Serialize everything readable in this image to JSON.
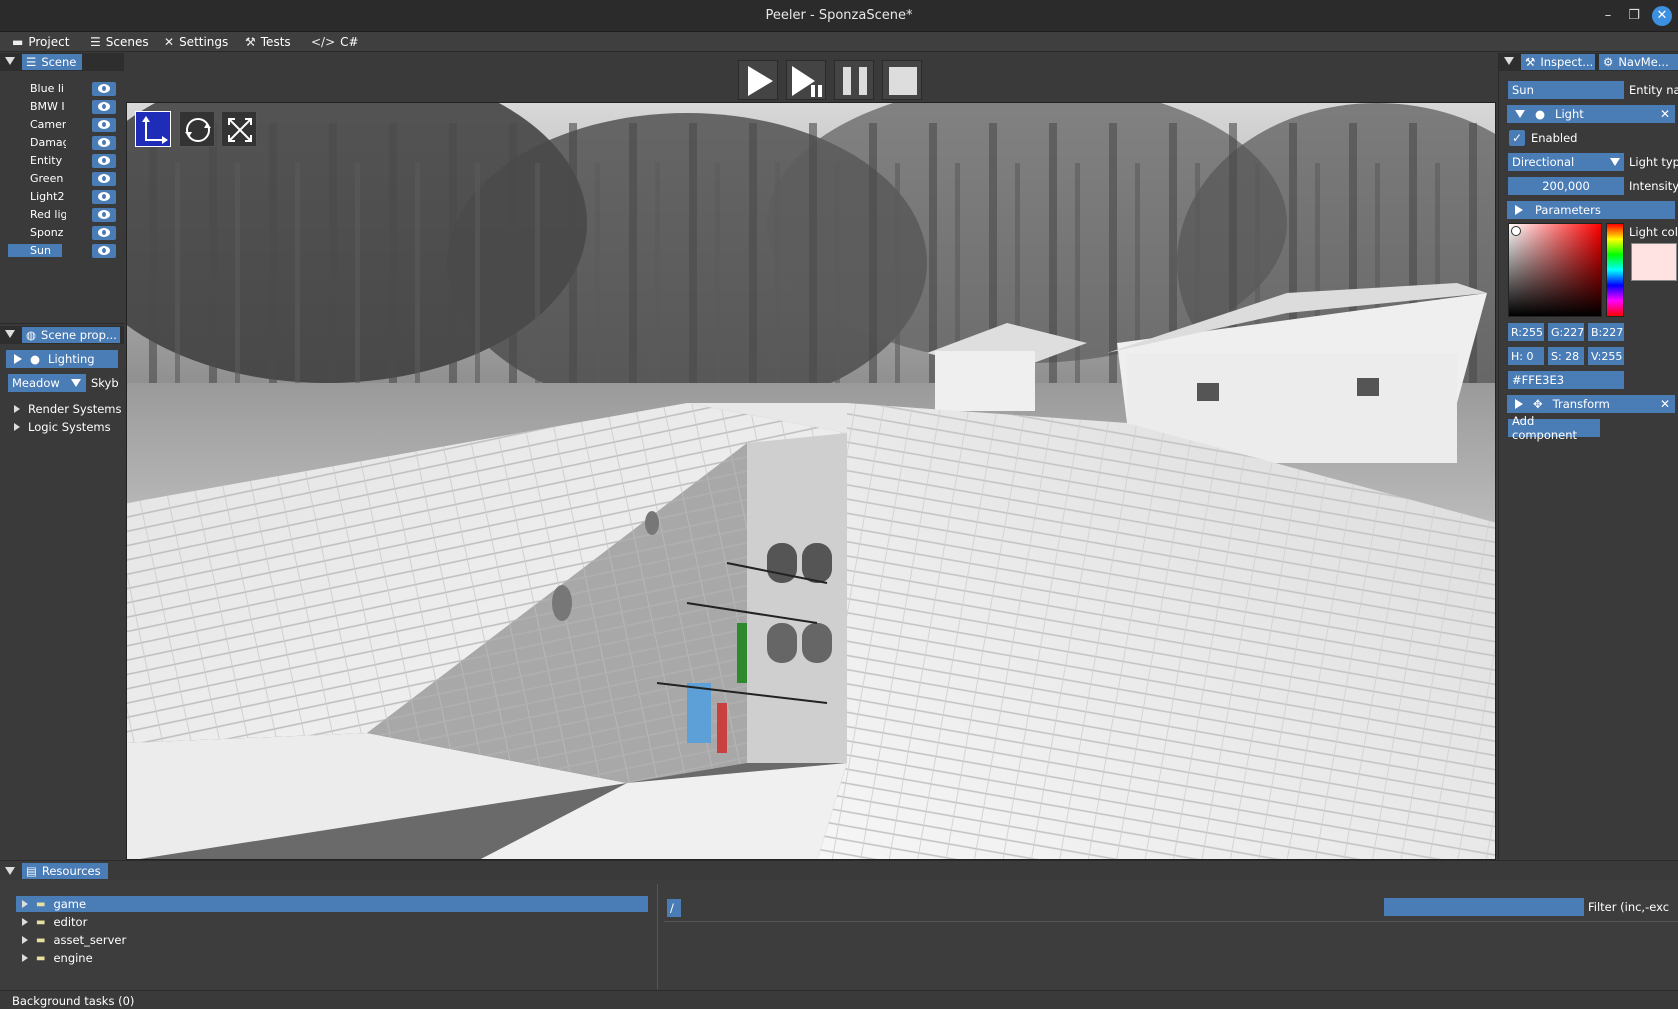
{
  "window": {
    "title": "Peeler - SponzaScene*",
    "minimize": "–",
    "maximize": "❐",
    "close": "✕"
  },
  "menu": {
    "items": [
      {
        "label": "Project",
        "icon": "folder-icon"
      },
      {
        "label": "Scenes",
        "icon": "list-icon"
      },
      {
        "label": "Settings",
        "icon": "tools-icon"
      },
      {
        "label": "Tests",
        "icon": "wrench-icon"
      },
      {
        "label": "C#",
        "icon": "code-icon"
      }
    ]
  },
  "scene_panel": {
    "tab": "Scene",
    "entities": [
      {
        "name": "Blue li",
        "selected": false
      },
      {
        "name": "BMW I",
        "selected": false
      },
      {
        "name": "Camer",
        "selected": false
      },
      {
        "name": "Damag",
        "selected": false
      },
      {
        "name": "Entity",
        "selected": false
      },
      {
        "name": "Green",
        "selected": false
      },
      {
        "name": "Light2",
        "selected": false
      },
      {
        "name": "Red lig",
        "selected": false
      },
      {
        "name": "Sponz",
        "selected": false
      },
      {
        "name": "Sun",
        "selected": true
      }
    ]
  },
  "scene_props": {
    "tab": "Scene prop...",
    "lighting": "Lighting",
    "skybox_value": "Meadow",
    "skybox_label": "Skyb",
    "render_systems": "Render Systems",
    "logic_systems": "Logic Systems"
  },
  "inspector": {
    "tab_inspector": "Inspect...",
    "tab_navmesh": "NavMe...",
    "entity_name_value": "Sun",
    "entity_name_label": "Entity nar",
    "light_header": "Light",
    "enabled_label": "Enabled",
    "light_type_value": "Directional",
    "light_type_label": "Light typ",
    "intensity_value": "200,000",
    "intensity_label": "Intensity",
    "parameters": "Parameters",
    "light_color_label": "Light colo",
    "r": "R:255",
    "g": "G:227",
    "b": "B:227",
    "h": "H: 0",
    "s": "S: 28",
    "v": "V:255",
    "hex": "#FFE3E3",
    "transform": "Transform",
    "add_component": "Add component",
    "color": "#FFE3E3"
  },
  "resources": {
    "tab": "Resources",
    "tree": [
      {
        "name": "game",
        "selected": true
      },
      {
        "name": "editor",
        "selected": false
      },
      {
        "name": "asset_server",
        "selected": false
      },
      {
        "name": "engine",
        "selected": false
      }
    ],
    "path": "/",
    "filter_label": "Filter (inc,-exc"
  },
  "status": {
    "background_tasks": "Background tasks (0)"
  },
  "colors": {
    "accent": "#4a7cb6",
    "panel": "#3a3a3a",
    "header": "#2e2e2e"
  }
}
